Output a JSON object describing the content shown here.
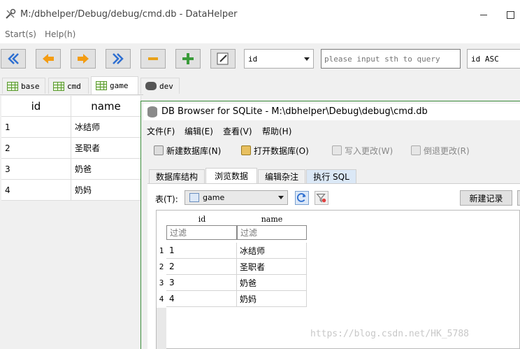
{
  "window": {
    "title": "M:/dbhelper/Debug/debug/cmd.db - DataHelper"
  },
  "menu": {
    "items": [
      "Start(s)",
      "Help(h)"
    ]
  },
  "toolbar": {
    "buttons": [
      "first-icon",
      "prev-icon",
      "next-icon",
      "last-icon",
      "minus-icon",
      "plus-icon",
      "edit-icon"
    ],
    "field_select": "id",
    "query_placeholder": "please input sth to query",
    "sort_value": "id ASC"
  },
  "tabs": [
    "base",
    "cmd",
    "game",
    "dev"
  ],
  "active_tab": "game",
  "main_table": {
    "columns": [
      "id",
      "name"
    ],
    "rows": [
      [
        "1",
        "冰结师"
      ],
      [
        "2",
        "圣职者"
      ],
      [
        "3",
        "奶爸"
      ],
      [
        "4",
        "奶妈"
      ]
    ]
  },
  "db_browser": {
    "title": "DB Browser for SQLite - M:\\dbhelper\\Debug\\debug\\cmd.db",
    "menu": [
      "文件(F)",
      "编辑(E)",
      "查看(V)",
      "帮助(H)"
    ],
    "toolbar": [
      "新建数据库(N)",
      "打开数据库(O)",
      "写入更改(W)",
      "倒退更改(R)"
    ],
    "tabs": [
      "数据库结构",
      "浏览数据",
      "编辑杂注",
      "执行 SQL"
    ],
    "active_tab": "浏览数据",
    "table_label": "表(T):",
    "table_value": "game",
    "new_record": "新建记录",
    "columns": [
      "id",
      "name"
    ],
    "filter_placeholder": "过滤",
    "row_numbers": [
      "1",
      "2",
      "3",
      "4"
    ],
    "rows": [
      [
        "1",
        "冰结师"
      ],
      [
        "2",
        "圣职者"
      ],
      [
        "3",
        "奶爸"
      ],
      [
        "4",
        "奶妈"
      ]
    ]
  },
  "watermark": "https://blog.csdn.net/HK_5788",
  "colors": {
    "accent_green": "#5a9b2e",
    "arrow_orange": "#f39c12",
    "nav_blue": "#2e6fd1"
  }
}
